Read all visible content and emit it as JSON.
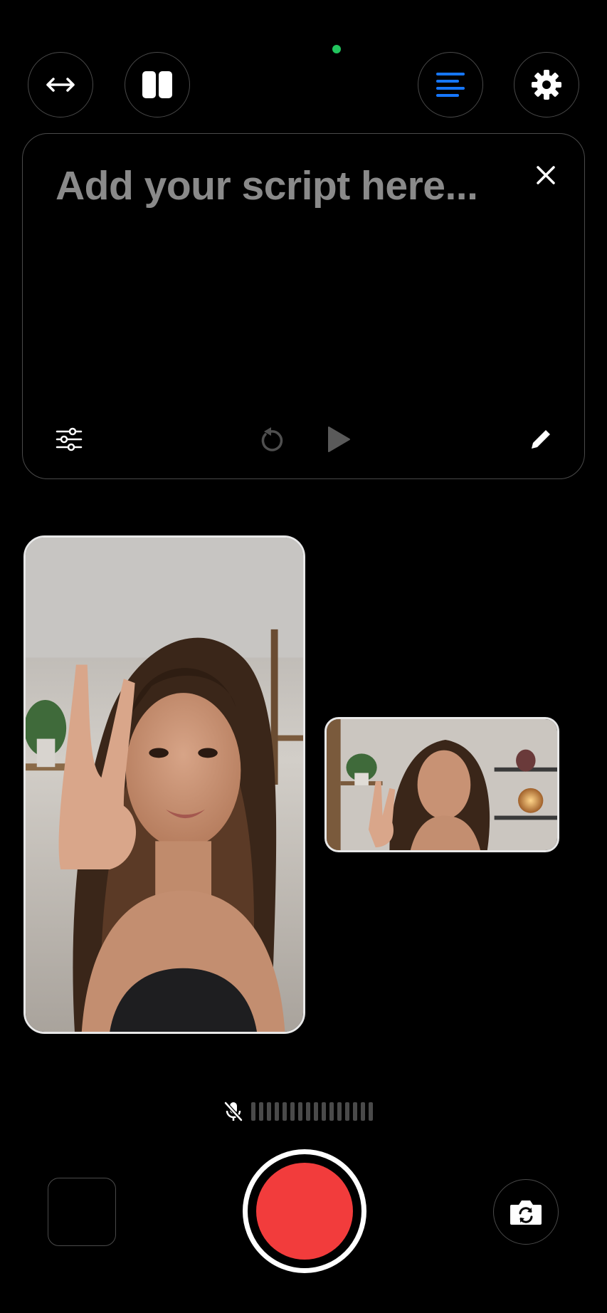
{
  "status": {
    "indicator_color": "#22c55e"
  },
  "top_bar": {
    "buttons": [
      {
        "name": "swap",
        "icon": "arrows-horizontal-icon"
      },
      {
        "name": "layout",
        "icon": "split-layout-icon"
      },
      {
        "name": "script",
        "icon": "align-left-icon",
        "active_color": "#1677ff"
      },
      {
        "name": "settings",
        "icon": "gear-icon"
      }
    ]
  },
  "script_panel": {
    "placeholder": "Add your script here...",
    "close_icon": "close-icon",
    "footer": {
      "adjust_icon": "sliders-icon",
      "reset_icon": "reset-icon",
      "play_icon": "play-icon",
      "edit_icon": "pencil-icon"
    }
  },
  "previews": {
    "portrait": {
      "label": "portrait-camera-preview"
    },
    "landscape": {
      "label": "landscape-camera-preview"
    }
  },
  "audio": {
    "muted_icon": "mic-off-icon",
    "meter_level": 0
  },
  "controls": {
    "record_color": "#f23c3c",
    "flip_icon": "camera-flip-icon"
  }
}
